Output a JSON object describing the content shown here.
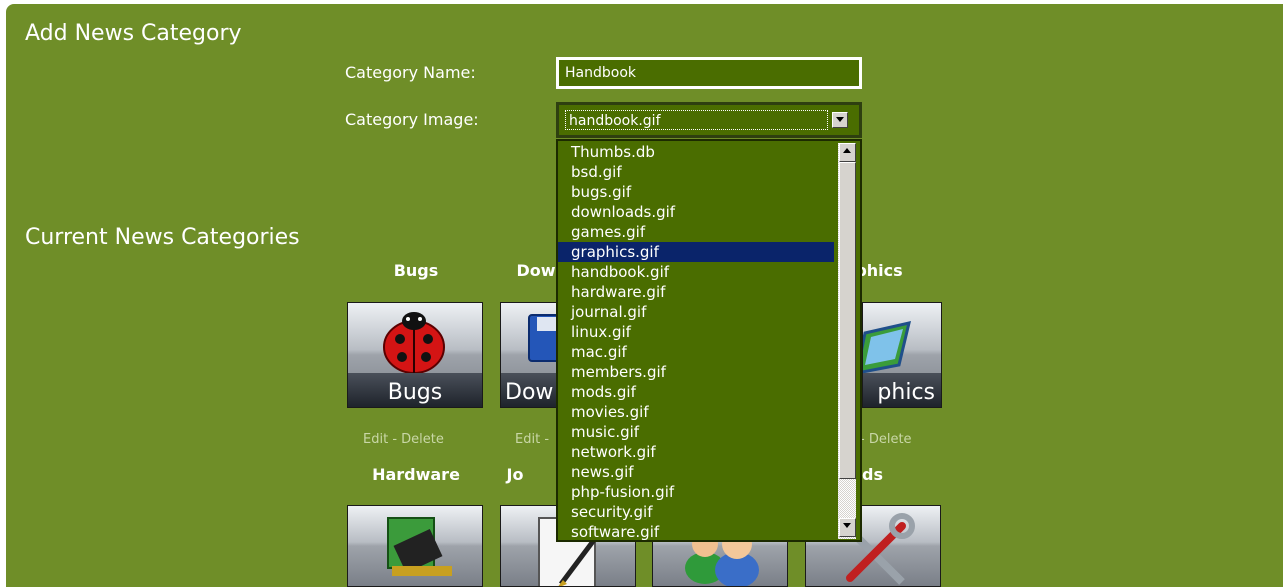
{
  "add_section": {
    "title": "Add News Category",
    "category_name_label": "Category Name:",
    "category_name_value": "Handbook",
    "category_image_label": "Category Image:",
    "category_image_value": "handbook.gif"
  },
  "dropdown": {
    "options": [
      "Thumbs.db",
      "bsd.gif",
      "bugs.gif",
      "downloads.gif",
      "games.gif",
      "graphics.gif",
      "handbook.gif",
      "hardware.gif",
      "journal.gif",
      "linux.gif",
      "mac.gif",
      "members.gif",
      "mods.gif",
      "movies.gif",
      "music.gif",
      "network.gif",
      "news.gif",
      "php-fusion.gif",
      "security.gif",
      "software.gif"
    ],
    "highlighted": "graphics.gif"
  },
  "current_section": {
    "title": "Current News Categories",
    "categories_row1": [
      {
        "name": "Bugs",
        "image_text": "Bugs",
        "icon": "ladybug-icon",
        "edit": "Edit",
        "sep": "-",
        "delete": "Delete"
      },
      {
        "name": "Dow",
        "image_text": "Dow",
        "icon": "floppy-disk-icon",
        "edit": "Edit",
        "sep": "-",
        "delete": ""
      },
      {
        "name": "phics",
        "image_text": "phics",
        "icon": "graphics-icon",
        "edit": "",
        "sep": "-",
        "delete": "Delete"
      }
    ],
    "categories_row2": [
      {
        "name": "Hardware",
        "icon": "circuit-board-icon"
      },
      {
        "name": "Jo",
        "icon": "journal-pen-icon"
      },
      {
        "name": "",
        "icon": "members-icon"
      },
      {
        "name": "ods",
        "icon": "tools-icon"
      }
    ]
  },
  "colors": {
    "panel_bg": "#6f8e28",
    "field_bg": "#4a6d00",
    "highlight": "#0a246a",
    "action_text": "#c9d7a7"
  }
}
